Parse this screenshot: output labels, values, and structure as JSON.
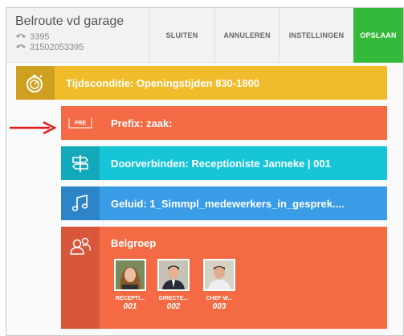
{
  "header": {
    "title": "Belroute vd garage",
    "extension": "3395",
    "phone_number": "31502053395",
    "buttons": {
      "close": "SLUITEN",
      "cancel": "ANNULEREN",
      "settings": "INSTELLINGEN",
      "save": "OPSLAAN"
    }
  },
  "route_steps": [
    {
      "type": "time-condition",
      "label": "Tijdsconditie: Openingstijden 830-1800",
      "icon": "stopwatch-icon",
      "color": "#f0bc2b"
    },
    {
      "type": "prefix",
      "label": "Prefix: zaak:",
      "icon": "prefix-tag-icon",
      "icon_text": "PRE",
      "color": "#f36a44"
    },
    {
      "type": "forward",
      "label": "Doorverbinden: Receptioniste Janneke | 001",
      "icon": "signpost-icon",
      "color": "#16c5d8"
    },
    {
      "type": "sound",
      "label": "Geluid: 1_Simmpl_medewerkers_in_gesprek....",
      "icon": "music-note-icon",
      "color": "#3a9ce6"
    }
  ],
  "ring_group": {
    "label": "Belgroep",
    "icon": "users-group-icon",
    "color": "#f36a44",
    "members": [
      {
        "name": "RECEPTI...",
        "number": "001"
      },
      {
        "name": "DIRECTE...",
        "number": "002"
      },
      {
        "name": "CHEF W...",
        "number": "003"
      }
    ]
  },
  "annotation": {
    "arrow_color": "#e01b1b"
  }
}
